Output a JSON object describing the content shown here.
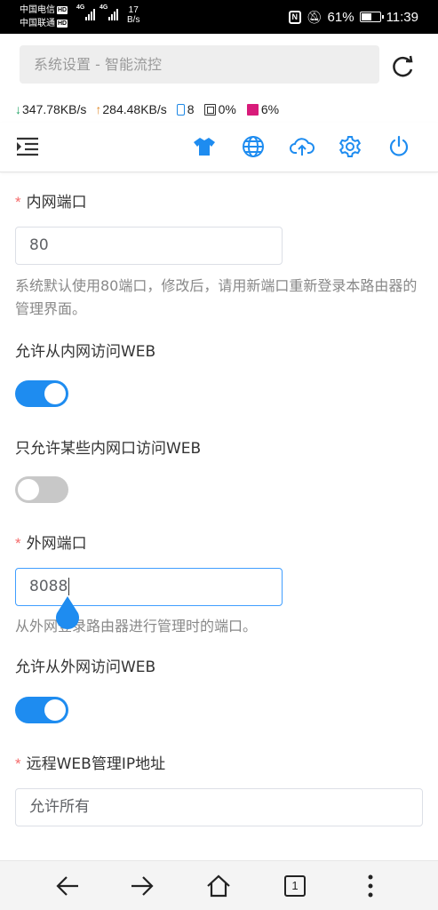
{
  "status_bar": {
    "carrier1": "中国电信",
    "carrier2": "中国联通",
    "hd_badge": "HD",
    "network1": "4G",
    "network2": "4G",
    "speed_value": "17",
    "speed_unit": "B/s",
    "battery_percent": "61%",
    "battery_level": 0.61,
    "time": "11:39",
    "nfc_label": "N"
  },
  "address_bar": {
    "url_text": "系统设置 - 智能流控"
  },
  "router_stats": {
    "download": "347.78KB/s",
    "upload": "284.48KB/s",
    "devices": "8",
    "cpu": "0%",
    "memory": "6%",
    "download_arrow": "↓",
    "upload_arrow": "↑"
  },
  "toolbar": {
    "accent": "#1e8cf0",
    "icons": [
      "menu-indent-icon",
      "tshirt-icon",
      "globe-icon",
      "cloud-upload-icon",
      "gear-icon",
      "power-icon"
    ]
  },
  "form": {
    "required_mark": "*",
    "lan_port_label": "内网端口",
    "lan_port_value": "80",
    "lan_port_hint": "系统默认使用80端口，修改后，请用新端口重新登录本路由器的管理界面。",
    "allow_lan_web_label": "允许从内网访问WEB",
    "allow_lan_web": true,
    "allow_some_lan_label": "只允许某些内网口访问WEB",
    "allow_some_lan": false,
    "wan_port_label": "外网端口",
    "wan_port_value": "8088",
    "wan_port_hint": "从外网登录路由器进行管理时的端口。",
    "allow_wan_web_label": "允许从外网访问WEB",
    "allow_wan_web": true,
    "remote_ip_label": "远程WEB管理IP地址",
    "remote_ip_value": "允许所有"
  },
  "bottom_nav": {
    "tab_count": "1",
    "icons": [
      "back-arrow-icon",
      "forward-arrow-icon",
      "home-icon",
      "tabs-icon",
      "more-icon"
    ]
  }
}
